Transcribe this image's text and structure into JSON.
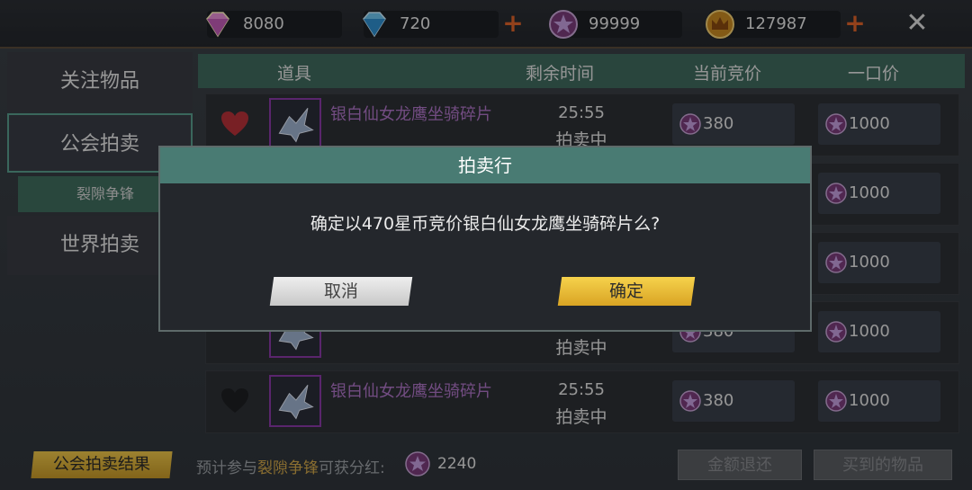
{
  "currencies": [
    {
      "icon": "pink-diamond-icon",
      "value": "8080"
    },
    {
      "icon": "blue-diamond-icon",
      "value": "720"
    },
    {
      "icon": "star-coin-icon",
      "value": "99999"
    },
    {
      "icon": "crown-coin-icon",
      "value": "127987"
    }
  ],
  "sidebar": {
    "tabs": [
      {
        "label": "关注物品"
      },
      {
        "label": "公会拍卖"
      },
      {
        "label": "世界拍卖"
      }
    ],
    "subtab": "裂隙争锋"
  },
  "table": {
    "headers": [
      "道具",
      "剩余时间",
      "当前竞价",
      "一口价"
    ],
    "rows": [
      {
        "name": "银白仙女龙鹰坐骑碎片",
        "time": "25:55",
        "status": "拍卖中",
        "bid": "380",
        "buyout": "1000"
      },
      {
        "name": "",
        "time": "",
        "status": "",
        "bid": "",
        "buyout": "1000"
      },
      {
        "name": "",
        "time": "",
        "status": "",
        "bid": "",
        "buyout": "1000"
      },
      {
        "name": "",
        "time": "",
        "status": "拍卖中",
        "bid": "380",
        "buyout": "1000"
      },
      {
        "name": "银白仙女龙鹰坐骑碎片",
        "time": "25:55",
        "status": "拍卖中",
        "bid": "380",
        "buyout": "1000"
      }
    ]
  },
  "footer": {
    "result_button": "公会拍卖结果",
    "text_prefix": "预计参与",
    "text_highlight": "裂隙争锋",
    "text_suffix": "可获分红:",
    "dividend": "2240",
    "refund_button": "金额退还",
    "bought_button": "买到的物品"
  },
  "dialog": {
    "title": "拍卖行",
    "message": "确定以470星币竞价银白仙女龙鹰坐骑碎片么?",
    "cancel": "取消",
    "confirm": "确定"
  },
  "colors": {
    "accent_teal": "#497b73",
    "confirm_yellow": "#f6d24c",
    "item_purple": "#b075c8",
    "plus_orange": "#e0642a"
  }
}
